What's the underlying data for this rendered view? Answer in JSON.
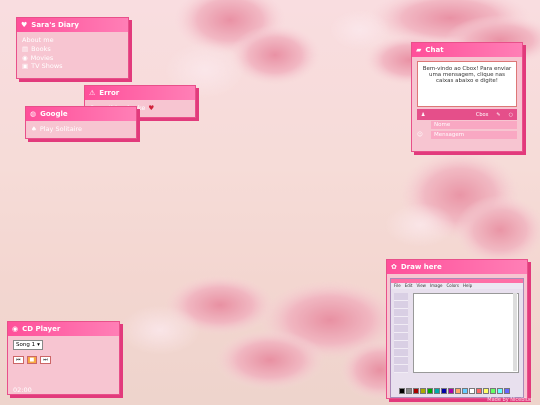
{
  "windows": {
    "diary": {
      "title": "Sara's Diary",
      "title_icon": "heart-icon",
      "heading": "About me",
      "links": [
        {
          "label": "Books",
          "icon": "book-icon"
        },
        {
          "label": "Movies",
          "icon": "disc-icon"
        },
        {
          "label": "TV Shows",
          "icon": "tv-icon"
        }
      ]
    },
    "error": {
      "title": "Error",
      "title_icon": "warning-icon",
      "message": "Something broke",
      "message_icon": "heart-icon"
    },
    "google": {
      "title": "Google",
      "title_icon": "globe-icon",
      "link": "Play Solitaire",
      "link_icon": "cards-icon"
    },
    "chat": {
      "title": "Chat",
      "title_icon": "chat-bubble-icon",
      "welcome": "Bem-vindo ao Cbox! Para enviar uma mensagem, clique nas caixas abaixo e digite!",
      "brand": "Cbox",
      "name_placeholder": "Nome",
      "message_placeholder": "Mensagem"
    },
    "draw": {
      "title": "Draw here",
      "title_icon": "palette-icon",
      "menu": [
        "File",
        "Edit",
        "View",
        "Image",
        "Colors",
        "Help"
      ]
    },
    "cd": {
      "title": "CD Player",
      "title_icon": "cd-icon",
      "selected_song": "Song 1",
      "time": "02:00",
      "controls": [
        "prev-icon",
        "stop-icon",
        "next-icon"
      ]
    }
  },
  "footer": {
    "watermark": "Made by Niceblue"
  },
  "colors": {
    "accent": "#ff4f9a",
    "window": "#f7c5d1",
    "shadow": "#e23a7c"
  }
}
